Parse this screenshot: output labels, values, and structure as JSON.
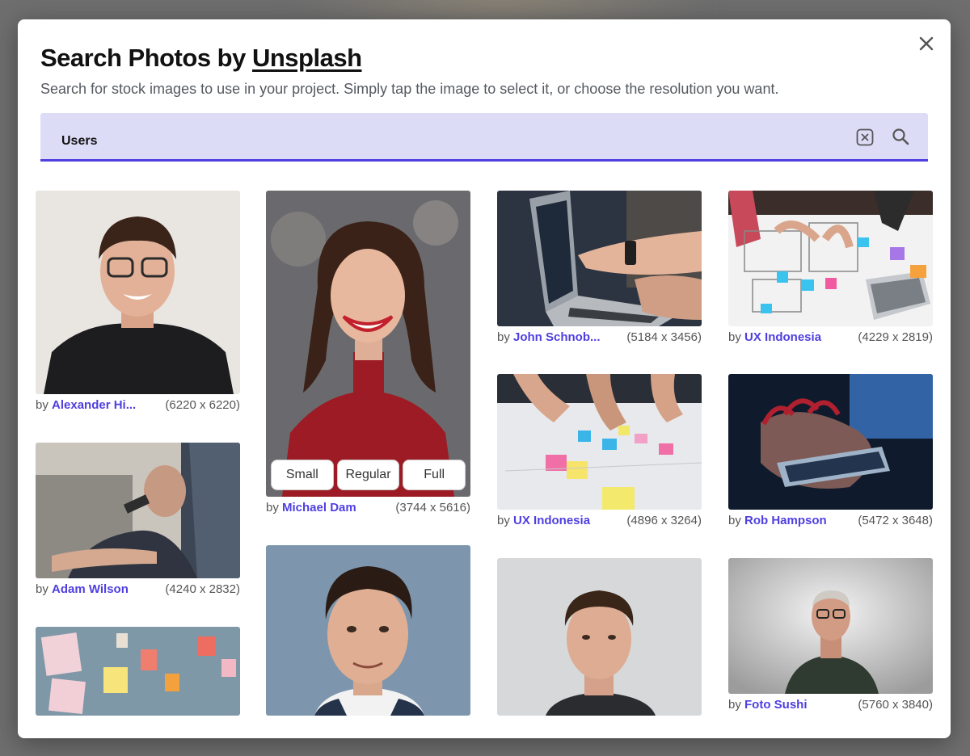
{
  "dialog": {
    "title_prefix": "Search Photos by ",
    "title_link": "Unsplash",
    "subtitle": "Search for stock images to use in your project. Simply tap the image to select it, or choose the resolution you want.",
    "close_icon": "close-icon"
  },
  "search": {
    "value": "Users",
    "clear_icon": "clear-search-icon",
    "search_icon": "search-icon"
  },
  "by_label": "by",
  "resolution_buttons": {
    "small": "Small",
    "regular": "Regular",
    "full": "Full"
  },
  "photos": [
    {
      "author": "Alexander Hi...",
      "dims": "(6220 x 6220)"
    },
    {
      "author": "Adam Wilson",
      "dims": "(4240 x 2832)"
    },
    {
      "author": "Michael Dam",
      "dims": "(3744 x 5616)"
    },
    {
      "author": "John Schnob...",
      "dims": "(5184 x 3456)"
    },
    {
      "author": "UX Indonesia",
      "dims": "(4896 x 3264)"
    },
    {
      "author": "UX Indonesia",
      "dims": "(4229 x 2819)"
    },
    {
      "author": "Rob Hampson",
      "dims": "(5472 x 3648)"
    },
    {
      "author": "Foto Sushi",
      "dims": "(5760 x 3840)"
    }
  ],
  "colors": {
    "accent": "#4f3fe0",
    "search_bg": "#dcdcf7",
    "overlay": "#6e6e6e"
  }
}
